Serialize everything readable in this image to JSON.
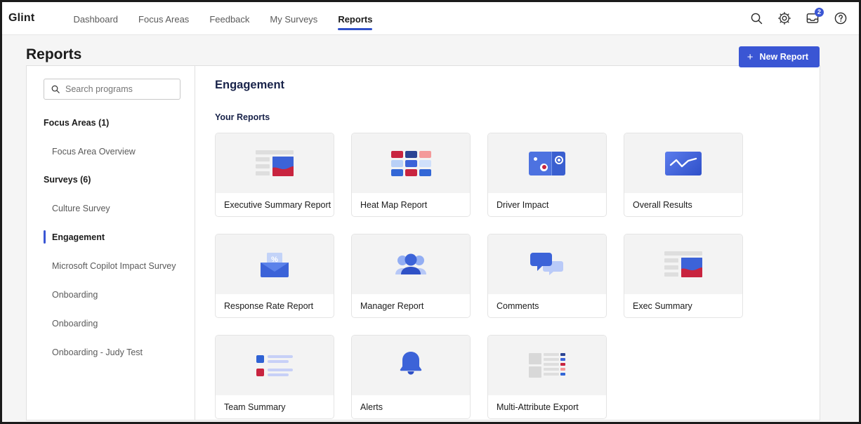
{
  "brand": "Glint",
  "nav": {
    "links": [
      {
        "label": "Dashboard",
        "active": false
      },
      {
        "label": "Focus Areas",
        "active": false
      },
      {
        "label": "Feedback",
        "active": false
      },
      {
        "label": "My Surveys",
        "active": false
      },
      {
        "label": "Reports",
        "active": true
      }
    ],
    "icons": [
      {
        "name": "search-icon"
      },
      {
        "name": "gear-icon"
      },
      {
        "name": "inbox-icon",
        "badge": "2"
      },
      {
        "name": "help-icon"
      }
    ]
  },
  "page": {
    "title": "Reports",
    "new_report_label": "New Report",
    "plus": "+"
  },
  "sidebar": {
    "search": {
      "placeholder": "Search programs",
      "value": ""
    },
    "groups": [
      {
        "title": "Focus Areas",
        "count": "(1)",
        "items": [
          {
            "label": "Focus Area Overview",
            "selected": false
          }
        ]
      },
      {
        "title": "Surveys",
        "count": "(6)",
        "items": [
          {
            "label": "Culture Survey",
            "selected": false
          },
          {
            "label": "Engagement",
            "selected": true
          },
          {
            "label": "Microsoft Copilot Impact Survey",
            "selected": false
          },
          {
            "label": "Onboarding",
            "selected": false
          },
          {
            "label": "Onboarding",
            "selected": false
          },
          {
            "label": "Onboarding - Judy Test",
            "selected": false
          }
        ]
      }
    ]
  },
  "main": {
    "heading": "Engagement",
    "subheading": "Your Reports",
    "cards": [
      {
        "label": "Executive Summary Report",
        "icon": "exec-summary-icon",
        "selected": false
      },
      {
        "label": "Heat Map Report",
        "icon": "heat-map-icon",
        "selected": false
      },
      {
        "label": "Driver Impact",
        "icon": "driver-impact-icon",
        "selected": false
      },
      {
        "label": "Overall Results",
        "icon": "trend-line-icon",
        "selected": true
      },
      {
        "label": "Response Rate Report",
        "icon": "envelope-percent-icon",
        "selected": false
      },
      {
        "label": "Manager Report",
        "icon": "people-group-icon",
        "selected": false
      },
      {
        "label": "Comments",
        "icon": "speech-bubbles-icon",
        "selected": false
      },
      {
        "label": "Exec Summary",
        "icon": "exec-summary-icon",
        "selected": false
      },
      {
        "label": "Team Summary",
        "icon": "team-list-icon",
        "selected": false
      },
      {
        "label": "Alerts",
        "icon": "bell-icon",
        "selected": false
      },
      {
        "label": "Multi-Attribute Export",
        "icon": "table-export-icon",
        "selected": false
      }
    ]
  },
  "colors": {
    "accent_blue": "#3a56d4",
    "selection_blue": "#5b9bef",
    "chart_red": "#c8243f",
    "chart_navy": "#2b4494",
    "card_bg": "#f3f3f3"
  }
}
